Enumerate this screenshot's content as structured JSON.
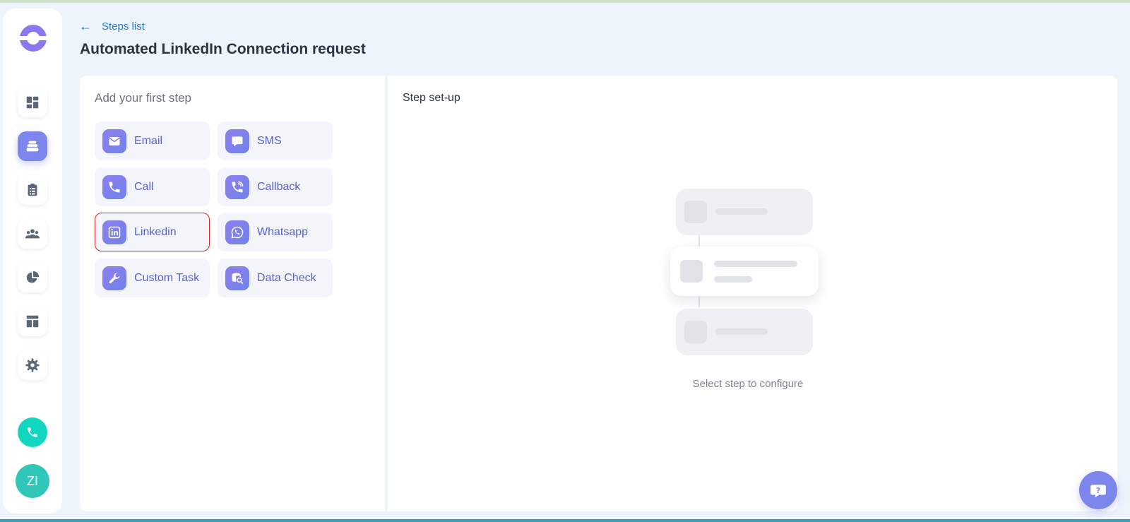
{
  "header": {
    "back_label": "Steps list",
    "title": "Automated LinkedIn Connection request"
  },
  "sidebar": {
    "avatar_initials": "ZI",
    "items": [
      {
        "icon": "dashboard-icon",
        "active": false
      },
      {
        "icon": "sequences-icon",
        "active": true
      },
      {
        "icon": "clipboard-icon",
        "active": false
      },
      {
        "icon": "users-icon",
        "active": false
      },
      {
        "icon": "pie-chart-icon",
        "active": false
      },
      {
        "icon": "layout-icon",
        "active": false
      },
      {
        "icon": "gear-icon",
        "active": false
      }
    ]
  },
  "steps_panel": {
    "heading": "Add your first step",
    "steps": [
      {
        "label": "Email",
        "icon": "mail-icon"
      },
      {
        "label": "SMS",
        "icon": "chat-bubble-icon"
      },
      {
        "label": "Call",
        "icon": "phone-icon"
      },
      {
        "label": "Callback",
        "icon": "phone-callback-icon"
      },
      {
        "label": "Linkedin",
        "icon": "linkedin-icon",
        "selected": true
      },
      {
        "label": "Whatsapp",
        "icon": "whatsapp-icon"
      },
      {
        "label": "Custom Task",
        "icon": "wrench-icon"
      },
      {
        "label": "Data Check",
        "icon": "database-search-icon"
      }
    ]
  },
  "setup_panel": {
    "heading": "Step set-up",
    "empty_text": "Select step to configure"
  },
  "colors": {
    "accent": "#7c86ec",
    "link": "#1f7bd6",
    "selected_border": "#e02424",
    "phone_button": "#11d6c0"
  }
}
